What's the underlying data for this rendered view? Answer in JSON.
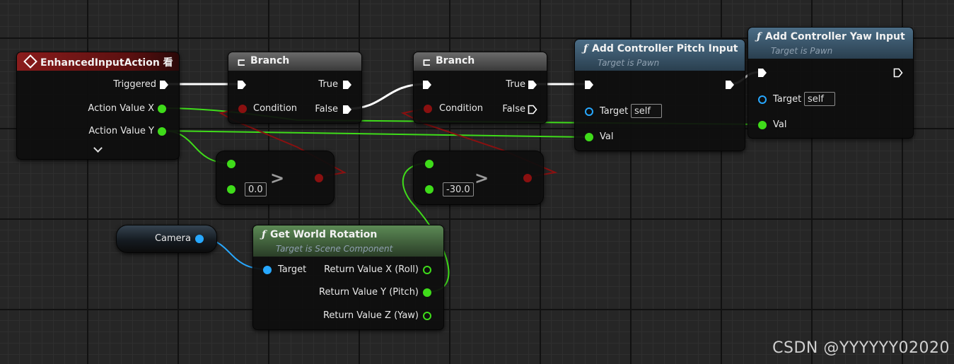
{
  "nodes": {
    "enhanced": {
      "title": "EnhancedInputAction 看",
      "pins": {
        "triggered": "Triggered",
        "action_x": "Action Value X",
        "action_y": "Action Value Y"
      }
    },
    "branch1": {
      "title": "Branch",
      "pins": {
        "condition": "Condition",
        "true": "True",
        "false": "False"
      }
    },
    "branch2": {
      "title": "Branch",
      "pins": {
        "condition": "Condition",
        "true": "True",
        "false": "False"
      }
    },
    "compare1": {
      "operator": ">",
      "value": "0.0"
    },
    "compare2": {
      "operator": ">",
      "value": "-30.0"
    },
    "pitch": {
      "title": "Add Controller Pitch Input",
      "subtitle": "Target is Pawn",
      "pins": {
        "target": "Target",
        "target_value": "self",
        "val": "Val"
      }
    },
    "yaw": {
      "title": "Add Controller Yaw Input",
      "subtitle": "Target is Pawn",
      "pins": {
        "target": "Target",
        "target_value": "self",
        "val": "Val"
      }
    },
    "camera": {
      "label": "Camera"
    },
    "rotation": {
      "title": "Get World Rotation",
      "subtitle": "Target is Scene Component",
      "pins": {
        "target": "Target",
        "x": "Return Value X (Roll)",
        "y": "Return Value Y (Pitch)",
        "z": "Return Value Z (Yaw)"
      }
    }
  },
  "watermark": "CSDN @YYYYYY02020",
  "colors": {
    "exec": "#ffffff",
    "float": "#3fdc1a",
    "bool": "#8a1010",
    "object": "#27a8ff",
    "event_header": "#7a1818",
    "function_header": "#36576f",
    "pure_header": "#3f6a3a"
  }
}
